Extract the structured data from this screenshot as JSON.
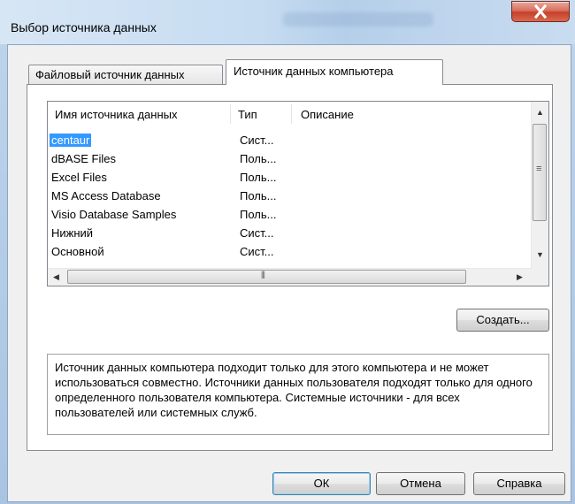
{
  "window": {
    "title": "Выбор источника данных"
  },
  "tabs": [
    {
      "label": "Файловый источник данных",
      "active": false
    },
    {
      "label": "Источник данных компьютера",
      "active": true
    }
  ],
  "table": {
    "headers": {
      "name": "Имя источника данных",
      "type": "Тип",
      "description": "Описание"
    },
    "rows": [
      {
        "name": "centaur",
        "type": "Сист..."
      },
      {
        "name": "dBASE Files",
        "type": "Поль..."
      },
      {
        "name": "Excel Files",
        "type": "Поль..."
      },
      {
        "name": "MS Access Database",
        "type": "Поль..."
      },
      {
        "name": "Visio Database Samples",
        "type": "Поль..."
      },
      {
        "name": "Нижний",
        "type": "Сист..."
      },
      {
        "name": "Основной",
        "type": "Сист..."
      }
    ],
    "selected_index": 0
  },
  "buttons": {
    "create": "Создать...",
    "ok": "ОК",
    "cancel": "Отмена",
    "help": "Справка"
  },
  "info_text": "Источник данных компьютера подходит только для этого компьютера и не может использоваться совместно.  Источники данных пользователя подходят только для одного определенного пользователя компьютера. Системные источники - для всех пользователей или системных служб.",
  "icons": [
    "close-icon",
    "scroll-up-icon",
    "scroll-down-icon",
    "scroll-left-icon",
    "scroll-right-icon"
  ],
  "colors": {
    "selection": "#3399ff",
    "close": "#c6402a"
  }
}
